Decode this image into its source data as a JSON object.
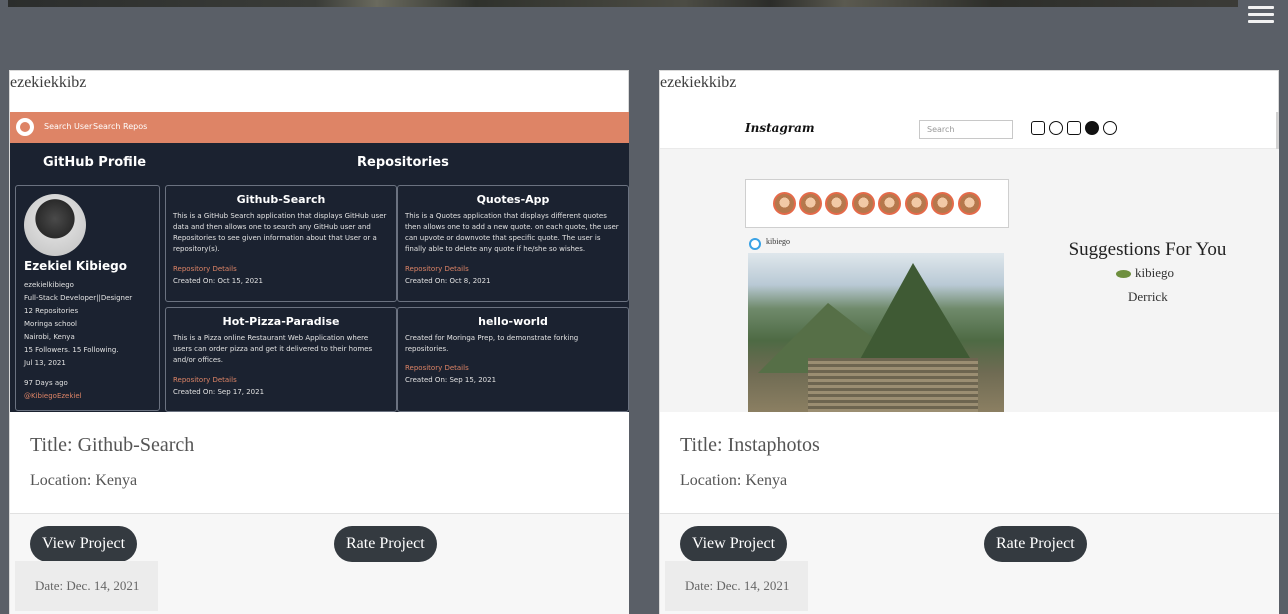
{
  "header": {
    "menu_icon": "hamburger-icon"
  },
  "projects": [
    {
      "owner": "ezekiekkibz",
      "title": "Title: Github-Search",
      "location": "Location: Kenya",
      "view_label": "View Project",
      "rate_label": "Rate Project",
      "date": "Date: Dec. 14, 2021",
      "screenshot": {
        "nav_links": [
          "Search User",
          "Search Repos"
        ],
        "profile_heading": "GitHub Profile",
        "repos_heading": "Repositories",
        "name": "Ezekiel Kibiego",
        "lines": [
          "ezekielkibiego",
          "Full-Stack Developer||Designer",
          "12 Repositories",
          "Moringa school",
          "Nairobi, Kenya",
          "15 Followers. 15 Following.",
          "Jul 13, 2021",
          "97 Days ago",
          "@KibiegoEzekiel"
        ],
        "repos": [
          {
            "name": "Github-Search",
            "desc": "This is a GitHub Search application that displays GitHub user data and then allows one to search any GitHub user and Repositories to see given information about that User or a repository(s).",
            "link": "Repository Details",
            "date": "Created On: Oct 15, 2021"
          },
          {
            "name": "Quotes-App",
            "desc": "This is a Quotes application that displays different quotes then allows one to add a new quote. on each quote, the user can upvote or downvote that specific quote. The user is finally able to delete any quote if he/she so wishes.",
            "link": "Repository Details",
            "date": "Created On: Oct 8, 2021"
          },
          {
            "name": "Hot-Pizza-Paradise",
            "desc": "This is a Pizza online Restaurant Web Application where users can order pizza and get it delivered to their homes and/or offices.",
            "link": "Repository Details",
            "date": "Created On: Sep 17, 2021"
          },
          {
            "name": "hello-world",
            "desc": "Created for Moringa Prep, to demonstrate forking repositories.",
            "link": "Repository Details",
            "date": "Created On: Sep 15, 2021"
          }
        ]
      }
    },
    {
      "owner": "ezekiekkibz",
      "title": "Title: Instaphotos",
      "location": "Location: Kenya",
      "view_label": "View Project",
      "rate_label": "Rate Project",
      "date": "Date: Dec. 14, 2021",
      "screenshot": {
        "logo": "Instagram",
        "search_placeholder": "Search",
        "post_user": "kibiego",
        "suggestions_heading": "Suggestions For You",
        "suggested_users": [
          "kibiego",
          "Derrick"
        ]
      }
    }
  ]
}
